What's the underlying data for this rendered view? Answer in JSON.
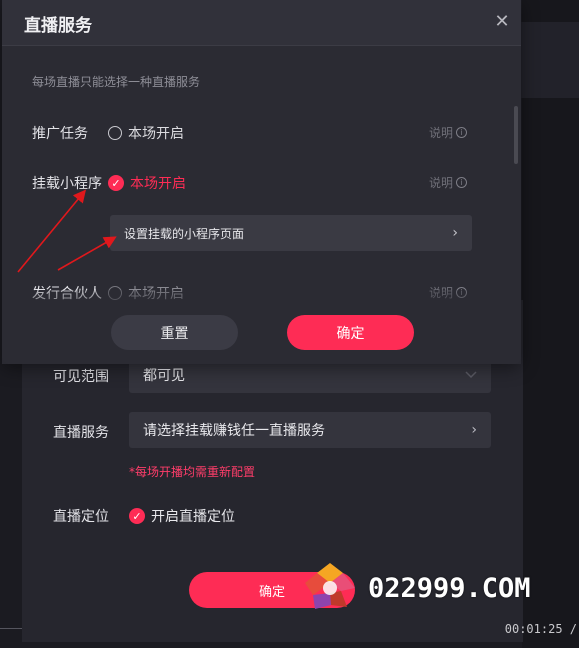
{
  "dialog": {
    "title": "直播服务",
    "close_icon": "close-icon",
    "hint": "每场直播只能选择一种直播服务",
    "services": [
      {
        "label": "推广任务",
        "option": "本场开启",
        "state": "unchecked",
        "explain": "说明"
      },
      {
        "label": "挂载小程序",
        "option": "本场开启",
        "state": "checked",
        "explain": "说明"
      },
      {
        "label": "发行合伙人",
        "option": "本场开启",
        "state": "unchecked",
        "explain": "说明"
      }
    ],
    "set_page_label": "设置挂载的小程序页面",
    "set_page_arrow": "›",
    "reset_label": "重置",
    "confirm_label": "确定"
  },
  "background_form": {
    "visibility_label": "可见范围",
    "visibility_value": "都可见",
    "service_label": "直播服务",
    "service_value": "请选择挂载赚钱任一直播服务",
    "service_arrow": "›",
    "warning": "*每场开播均需重新配置",
    "location_label": "直播定位",
    "location_option": "开启直播定位",
    "confirm_label": "确定",
    "time": "00:01:25 /"
  },
  "watermark": {
    "text": "022999.COM"
  },
  "colors": {
    "accent": "#fe2c55",
    "dialog_bg": "#2b2b33",
    "annotation_arrow": "#e0181c"
  }
}
